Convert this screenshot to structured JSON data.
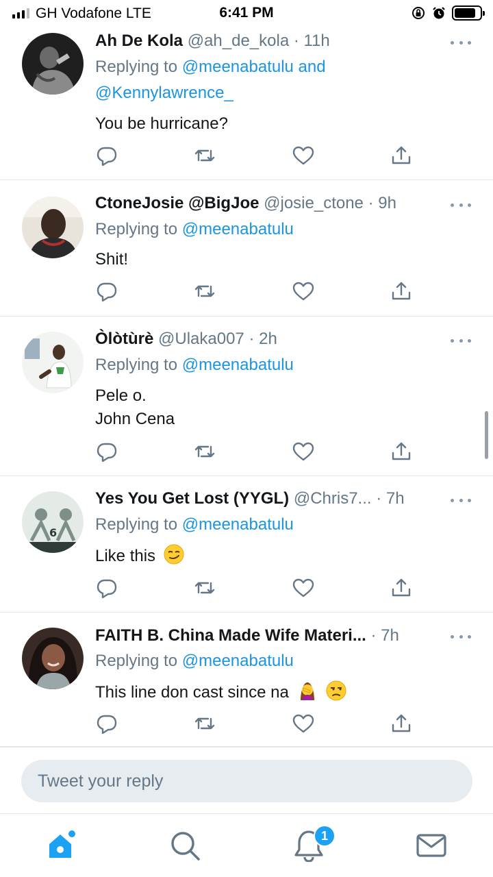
{
  "status_bar": {
    "carrier": "GH Vodafone  LTE",
    "time": "6:41 PM"
  },
  "tweets": [
    {
      "name": "Ah De Kola",
      "handle": "@ah_de_kola",
      "time": "· 11h",
      "replying_prefix": "Replying to ",
      "mention1": "@meenabatulu",
      "mention_joiner": " and",
      "mention2": "@Kennylawrence_",
      "lines": [
        "You be hurricane?"
      ],
      "avatar_color": "#2b2b2b"
    },
    {
      "name": "CtoneJosie @BigJoe",
      "handle": "@josie_ctone",
      "time": "· 9h",
      "replying_prefix": "Replying to ",
      "mention1": "@meenabatulu",
      "lines": [
        "Shit!"
      ],
      "avatar_color": "#d9d4cc"
    },
    {
      "name": "Òlòtùrè",
      "handle": "@Ulaka007",
      "time": "· 2h",
      "replying_prefix": "Replying to ",
      "mention1": "@meenabatulu",
      "lines": [
        "Pele o.",
        "John Cena"
      ],
      "avatar_color": "#eef1ee"
    },
    {
      "name": "Yes You Get Lost (YYGL)",
      "handle": "@Chris7...",
      "time": "· 7h",
      "replying_prefix": "Replying to ",
      "mention1": "@meenabatulu",
      "lines": [
        "Like this"
      ],
      "emoji": [
        "smirking-face"
      ],
      "avatar_color": "#dfe6e2"
    },
    {
      "name": "FAITH B. China Made Wife Materi...",
      "handle": "",
      "time": "· 7h",
      "replying_prefix": "Replying to ",
      "mention1": "@meenabatulu",
      "lines": [
        "This line don cast since na"
      ],
      "emoji": [
        "woman-facepalming",
        "unamused-face"
      ],
      "avatar_color": "#3a2a26"
    }
  ],
  "reply": {
    "placeholder": "Tweet your reply"
  },
  "tab_bar": {
    "items": [
      "home-icon",
      "search-icon",
      "notifications-icon",
      "messages-icon"
    ],
    "notification_count": "1"
  },
  "colors": {
    "accent": "#1da1f2",
    "mention": "#1b95e0",
    "secondary_text": "#657786",
    "divider": "#e1e8ed"
  }
}
